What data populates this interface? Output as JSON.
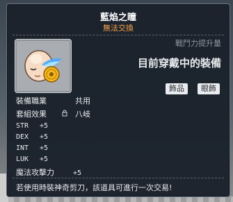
{
  "item": {
    "name": "藍焰之瞳",
    "trade_status": "無法交換"
  },
  "panel": {
    "attack_gain_label": "戰鬥力提升量",
    "equipped_status": "目前穿戴中的裝備",
    "tags": [
      "飾品",
      "眼飾"
    ]
  },
  "job": {
    "label": "裝備職業",
    "value": "共用"
  },
  "set_effect": {
    "label": "套組效果",
    "value": "八岐"
  },
  "stats": [
    {
      "name": "STR",
      "value": "+5"
    },
    {
      "name": "DEX",
      "value": "+5"
    },
    {
      "name": "INT",
      "value": "+5"
    },
    {
      "name": "LUK",
      "value": "+5"
    }
  ],
  "magic_attack": {
    "name": "魔法攻擊力",
    "value": "+5"
  },
  "notice": "若使用時裝神奇剪刀，該道具可進行一次交易!",
  "colors": {
    "trade_status": "#f7a34a",
    "panel_bg": "#1b222b",
    "text": "#e8ecef",
    "tag_bg": "#e9ebee"
  },
  "icons": {
    "item_icon": "bald-head-with-blue-flame-eye-icon",
    "lock": "lock-icon"
  }
}
